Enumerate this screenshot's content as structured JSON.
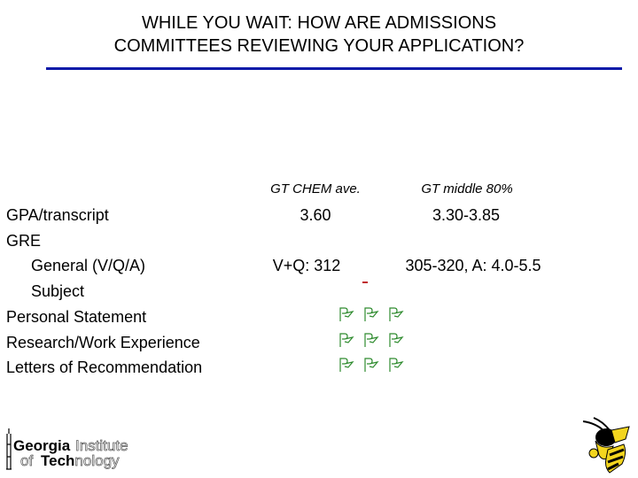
{
  "slide": {
    "title_line1": "WHILE YOU WAIT: HOW ARE ADMISSIONS",
    "title_line2": "COMMITTEES REVIEWING YOUR APPLICATION?",
    "rule_color": "#0c1aa8"
  },
  "columns": {
    "ave_header": "GT CHEM ave.",
    "range_header": "GT middle 80%"
  },
  "rows": [
    {
      "label": "GPA/transcript",
      "ave": "3.60",
      "range": "3.30-3.85"
    },
    {
      "label": "GRE",
      "ave": "",
      "range": ""
    },
    {
      "label": "General (V/Q/A)",
      "ave": "V+Q: 312",
      "range": "305-320, A: 4.0-5.5"
    },
    {
      "label": "Subject",
      "ave": "-",
      "range": ""
    },
    {
      "label": "Personal Statement",
      "marks": [
        "flag-icon",
        "flag-icon",
        "flag-icon"
      ]
    },
    {
      "label": "Research/Work Experience",
      "marks": [
        "flag-icon",
        "flag-icon",
        "flag-icon"
      ]
    },
    {
      "label": "Letters of Recommendation",
      "marks": [
        "flag-icon",
        "flag-icon",
        "flag-icon"
      ]
    }
  ],
  "colors": {
    "flag": "#2e8b2e",
    "dash": "#c0282b"
  },
  "logos": {
    "gt_word1": "Georgia",
    "gt_word2": "Institute",
    "gt_word3": "of",
    "gt_word4": "Technology",
    "mascot": "buzz-yellow-jacket"
  }
}
